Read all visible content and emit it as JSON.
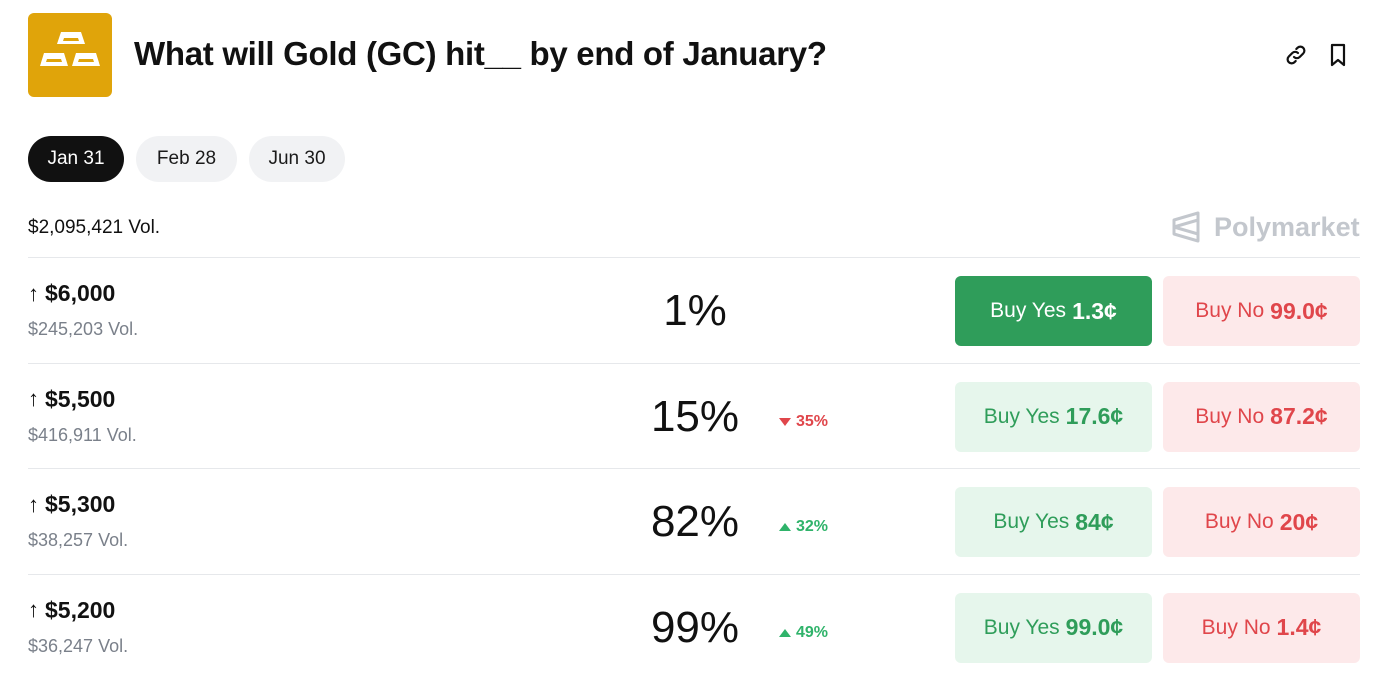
{
  "header": {
    "title": "What will Gold (GC) hit__ by end of January?",
    "logo_icon": "gold-bars-icon",
    "logo_color": "#E0A40A",
    "actions": [
      {
        "icon": "link-icon"
      },
      {
        "icon": "bookmark-icon"
      }
    ]
  },
  "tabs": [
    {
      "label": "Jan 31",
      "active": true
    },
    {
      "label": "Feb 28",
      "active": false
    },
    {
      "label": "Jun 30",
      "active": false
    }
  ],
  "volume": "$2,095,421 Vol.",
  "brand": {
    "name": "Polymarket",
    "icon": "polymarket-logo-icon"
  },
  "colors": {
    "accent_green": "#2f9d5a",
    "accent_red": "#e0464b",
    "yes_bg": "#e6f6ec",
    "no_bg": "#fde9ea"
  },
  "outcomes": [
    {
      "arrow": "↑",
      "label": "$6,000",
      "volume": "$245,203 Vol.",
      "probability": "1%",
      "delta": null,
      "buy_yes": {
        "label": "Buy Yes",
        "price": "1.3¢",
        "selected": true
      },
      "buy_no": {
        "label": "Buy No",
        "price": "99.0¢"
      }
    },
    {
      "arrow": "↑",
      "label": "$5,500",
      "volume": "$416,911 Vol.",
      "probability": "15%",
      "delta": {
        "direction": "down",
        "value": "35%"
      },
      "buy_yes": {
        "label": "Buy Yes",
        "price": "17.6¢",
        "selected": false
      },
      "buy_no": {
        "label": "Buy No",
        "price": "87.2¢"
      }
    },
    {
      "arrow": "↑",
      "label": "$5,300",
      "volume": "$38,257 Vol.",
      "probability": "82%",
      "delta": {
        "direction": "up",
        "value": "32%"
      },
      "buy_yes": {
        "label": "Buy Yes",
        "price": "84¢",
        "selected": false
      },
      "buy_no": {
        "label": "Buy No",
        "price": "20¢"
      }
    },
    {
      "arrow": "↑",
      "label": "$5,200",
      "volume": "$36,247 Vol.",
      "probability": "99%",
      "delta": {
        "direction": "up",
        "value": "49%"
      },
      "buy_yes": {
        "label": "Buy Yes",
        "price": "99.0¢",
        "selected": false
      },
      "buy_no": {
        "label": "Buy No",
        "price": "1.4¢"
      }
    }
  ]
}
